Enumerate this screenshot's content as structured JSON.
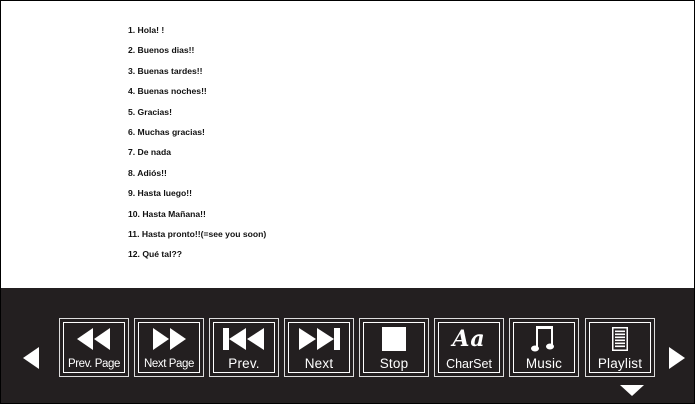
{
  "lyrics": [
    "1. Hola! !",
    "2. Buenos  dias!!",
    "3. Buenas tardes!!",
    "4. Buenas  noches!!",
    "5. Gracias!",
    "6. Muchas gracias!",
    "7. De nada",
    "8. Adiós!!",
    "9. Hasta luego!!",
    "10. Hasta Mañana!!",
    "11. Hasta pronto!!(=see you soon)",
    "12. Qué tal??"
  ],
  "toolbar": {
    "prev_page_label": "Prev. Page",
    "next_page_label": "Next Page",
    "prev_label": "Prev.",
    "next_label": "Next",
    "stop_label": "Stop",
    "charset_label": "CharSet",
    "charset_glyph": "Aa",
    "music_label": "Music",
    "playlist_label": "Playlist"
  },
  "colors": {
    "toolbar_bg": "#231f20",
    "icon": "#ffffff",
    "text": "#111111"
  },
  "icons": {
    "prev_page": "rewind-icon",
    "next_page": "fast-forward-icon",
    "prev": "skip-back-icon",
    "next": "skip-forward-icon",
    "stop": "stop-icon",
    "charset": "charset-icon",
    "music": "music-note-icon",
    "playlist": "playlist-icon"
  }
}
